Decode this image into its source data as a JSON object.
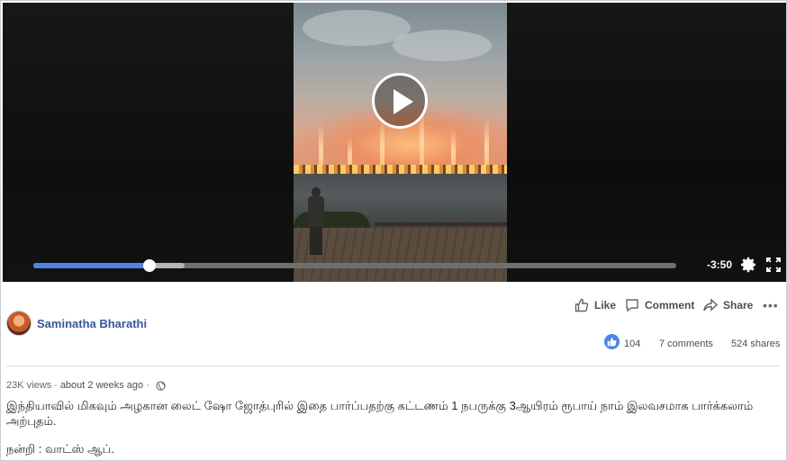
{
  "video": {
    "time_remaining": "-3:50",
    "progress_played": 0.18,
    "progress_buffered": 0.235
  },
  "post": {
    "author": "Saminatha Bharathi",
    "views": "23K views",
    "timestamp": "about 2 weeks ago",
    "description": "இந்தியாவில் மிகவும் அழகான லைட் ஷோ ஜோத்புரில் இதை பார்ப்பதற்கு கட்டணம் 1 நபருக்கு 3ஆயிரம் ரூபாய் நாம் இலவசமாக பார்க்கலாம் அற்புதம்.",
    "credit": "நன்றி : வாட்ஸ் ஆப்."
  },
  "actions": {
    "like_label": "Like",
    "comment_label": "Comment",
    "share_label": "Share",
    "more_label": "•••"
  },
  "stats": {
    "likes": "104",
    "comments": "7 comments",
    "shares": "524 shares"
  },
  "colors": {
    "accent": "#4a85e6",
    "link": "#365899",
    "text": "#1d2129",
    "muted": "#616770"
  },
  "icons": [
    "play-icon",
    "settings-gear-icon",
    "fullscreen-icon",
    "like-icon",
    "comment-icon",
    "share-icon",
    "more-options-icon",
    "like-reaction-icon",
    "globe-icon"
  ]
}
